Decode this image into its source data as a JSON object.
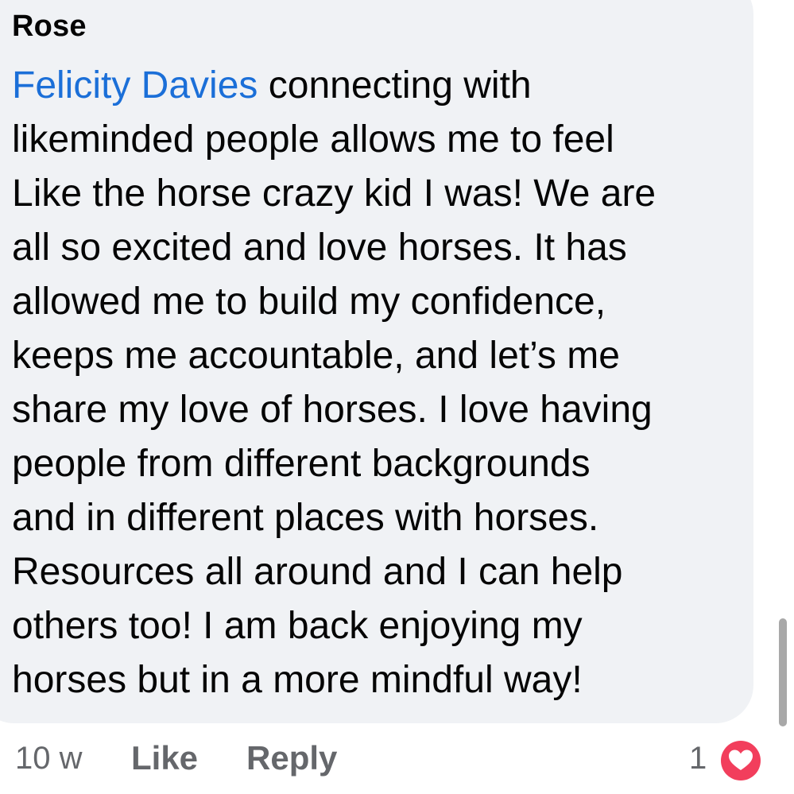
{
  "comment": {
    "author": "Rose",
    "mention": "Felicity Davies",
    "text_lines": [
      " connecting with",
      "likeminded people allows me to feel",
      "Like the horse crazy kid I was!  We are",
      "all so excited and love horses. It has",
      "allowed me to build my confidence,",
      "keeps me accountable, and let’s me",
      "share my love of horses. I love having",
      "people from different backgrounds",
      "and in different places with horses.",
      "Resources all around and I can help",
      "others too!  I am back enjoying my",
      "horses but in a more mindful way!"
    ]
  },
  "meta": {
    "timestamp": "10 w",
    "like_label": "Like",
    "reply_label": "Reply",
    "reaction_count": "1",
    "reaction_icon": "heart-icon"
  },
  "colors": {
    "bubble": "#f0f2f5",
    "mention": "#1b6fd8",
    "text": "#050505",
    "meta": "#65676b",
    "heart": "#f23e5c"
  }
}
